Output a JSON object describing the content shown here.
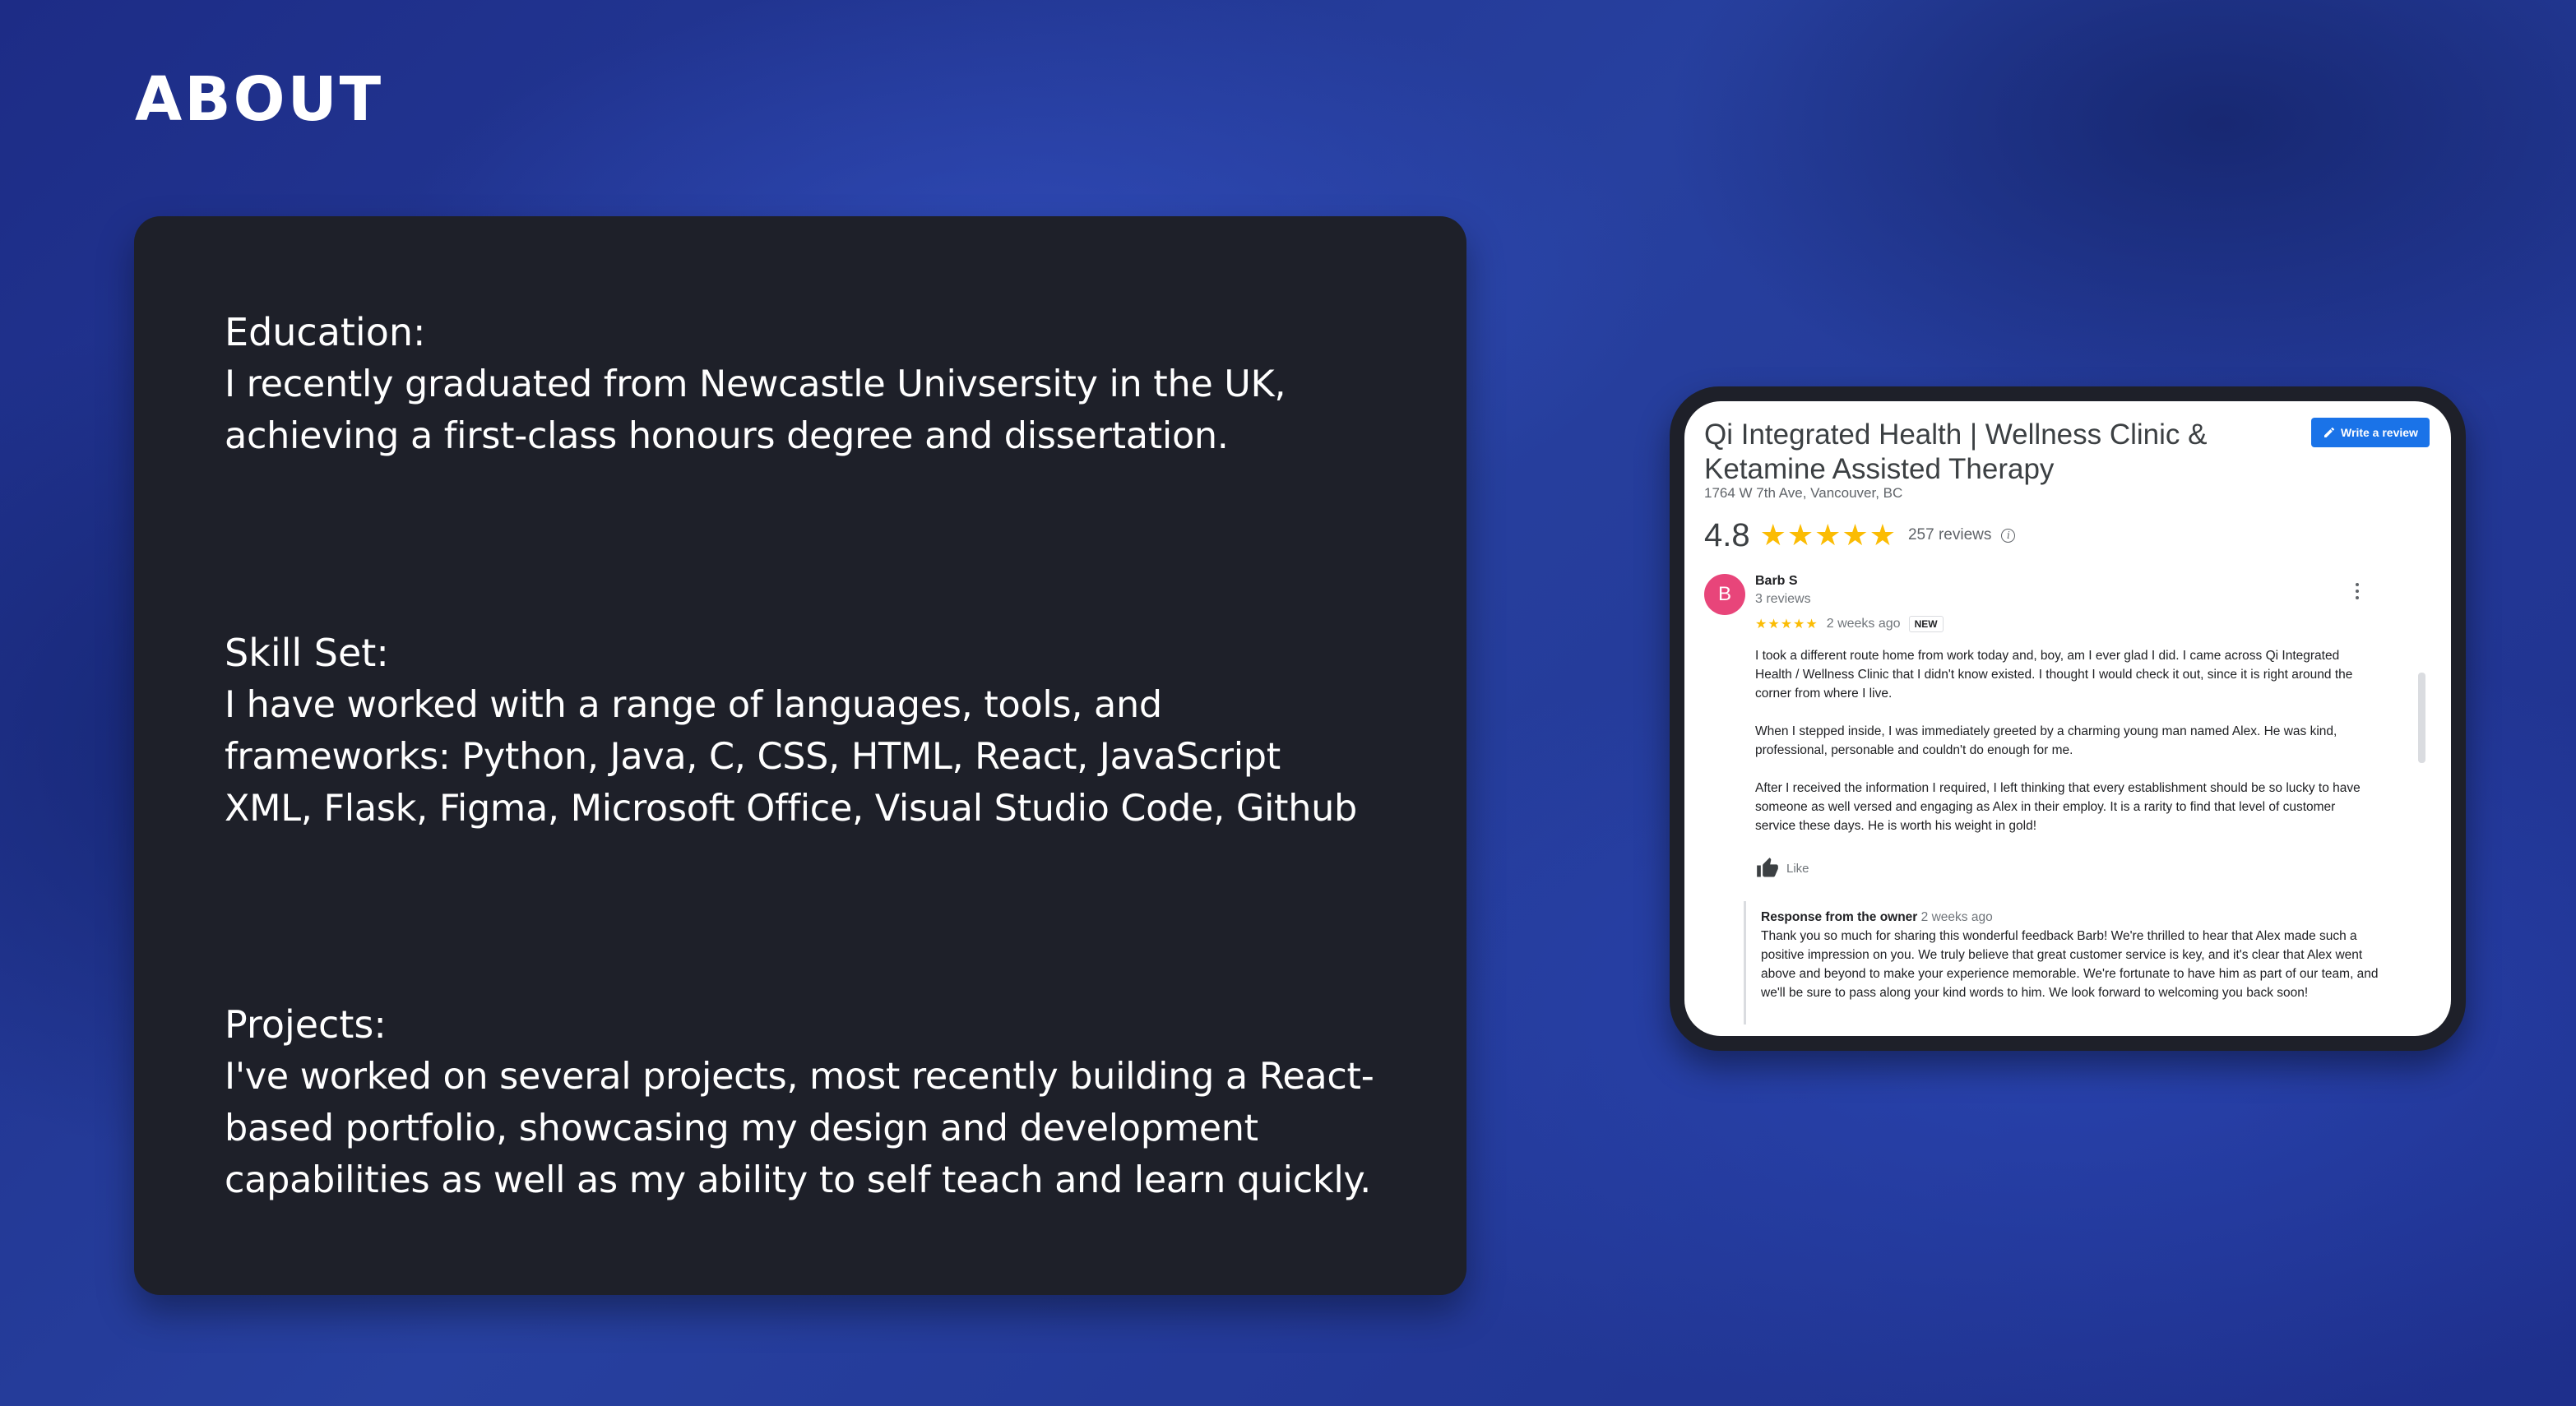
{
  "page": {
    "title": "ABOUT"
  },
  "about": {
    "education": {
      "heading": "Education:",
      "lines": [
        "I recently graduated from Newcastle Univsersity in the UK,",
        "achieving a first-class honours degree and dissertation."
      ]
    },
    "skills": {
      "heading": "Skill Set:",
      "lines": [
        "I have worked with a range of languages, tools, and",
        "frameworks: Python, Java, C, CSS, HTML, React, JavaScript",
        "XML, Flask, Figma, Microsoft Office, Visual Studio Code, Github"
      ]
    },
    "projects": {
      "heading": "Projects:",
      "lines": [
        "I've worked on several projects, most recently building a React-",
        "based portfolio, showcasing my design and development",
        "capabilities as well as my ability to self teach and learn quickly."
      ]
    }
  },
  "review_card": {
    "business_name_line1": "Qi Integrated Health | Wellness Clinic &",
    "business_name_line2": "Ketamine Assisted Therapy",
    "address": "1764 W 7th Ave, Vancouver, BC",
    "write_review_label": "Write a review",
    "rating": "4.8",
    "stars": "★★★★★",
    "review_count": "257 reviews",
    "review": {
      "avatar_letter": "B",
      "avatar_color": "#e8457a",
      "reviewer_name": "Barb S",
      "reviewer_reviews": "3 reviews",
      "stars": "★★★★★",
      "date": "2 weeks ago",
      "badge": "NEW",
      "paragraphs": [
        "I took a different route home from work today and, boy, am I ever glad I did. I came across Qi Integrated Health / Wellness Clinic that I didn't know existed. I thought I would check it out, since it is right around the corner from where I live.",
        "When I stepped inside, I was immediately greeted by a charming young man named Alex. He was kind, professional, personable and couldn't do enough for me.",
        "After I received the information I required, I left thinking that every establishment should be so lucky to have someone as well versed and engaging as Alex in their employ. It is a rarity to find that level of customer service these days. He is worth his weight in gold!"
      ],
      "like_label": "Like"
    },
    "owner_response": {
      "label": "Response from the owner",
      "date": "2 weeks ago",
      "text": "Thank you so much for sharing this wonderful feedback Barb! We're thrilled to hear that Alex made such a positive impression on you. We truly believe that great customer service is key, and it's clear that Alex went above and beyond to make your experience memorable. We're fortunate to have him as part of our team, and we'll be sure to pass along your kind words to him. We look forward to welcoming you back soon!"
    }
  },
  "colors": {
    "background": "#27409f",
    "card": "#1e2029",
    "star": "#fbbc04",
    "button": "#1a73e8"
  }
}
